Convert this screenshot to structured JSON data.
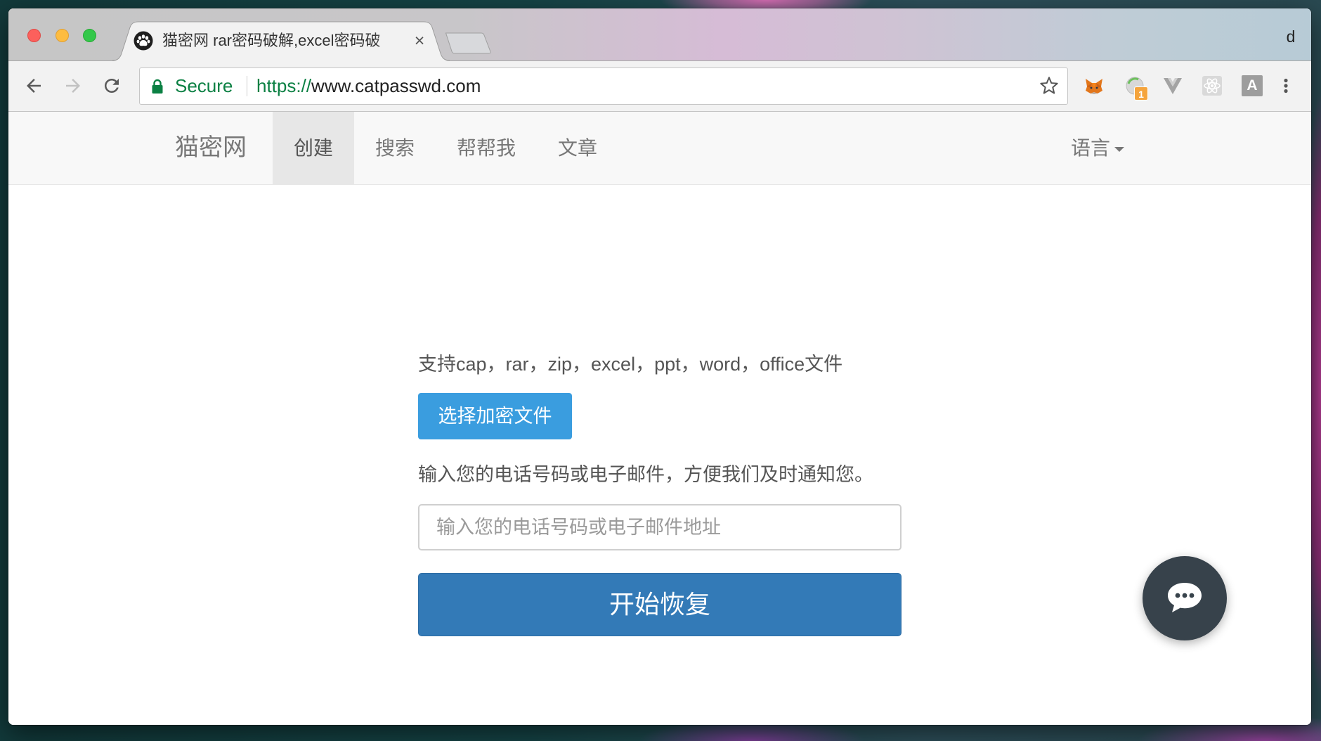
{
  "window": {
    "profile_initial": "d"
  },
  "tab": {
    "title": "猫密网 rar密码破解,excel密码破",
    "close_symbol": "×"
  },
  "toolbar": {
    "security_label": "Secure",
    "url_scheme": "https://",
    "url_host": "www.catpasswd.com",
    "extension_badge_count": "1",
    "extension_letter": "A"
  },
  "navbar": {
    "brand": "猫密网",
    "items": [
      {
        "label": "创建",
        "active": true
      },
      {
        "label": "搜索",
        "active": false
      },
      {
        "label": "帮帮我",
        "active": false
      },
      {
        "label": "文章",
        "active": false
      }
    ],
    "language_label": "语言"
  },
  "main": {
    "supported_formats": "支持cap，rar，zip，excel，ppt，word，office文件",
    "choose_file_button": "选择加密文件",
    "contact_prompt": "输入您的电话号码或电子邮件，方便我们及时通知您。",
    "contact_input": {
      "placeholder": "输入您的电话号码或电子邮件地址",
      "value": ""
    },
    "start_button": "开始恢复"
  },
  "icons": {
    "favicon": "cat-paw-icon",
    "back": "arrow-left-icon",
    "forward": "arrow-right-icon",
    "reload": "reload-icon",
    "security": "lock-icon",
    "bookmark": "star-icon",
    "extensions": [
      "fox-extension-icon",
      "circle-extension-icon",
      "vue-devtools-icon",
      "react-devtools-icon",
      "letter-a-extension-icon"
    ],
    "menu": "kebab-menu-icon",
    "chat": "chat-bubble-icon"
  },
  "colors": {
    "secure_green": "#0b8043",
    "choose_button_bg": "#3a9ddf",
    "start_button_bg": "#337ab7",
    "nav_active_bg": "#e7e7e7",
    "chat_widget_bg": "#37424b",
    "badge_bg": "#f5a43c"
  }
}
